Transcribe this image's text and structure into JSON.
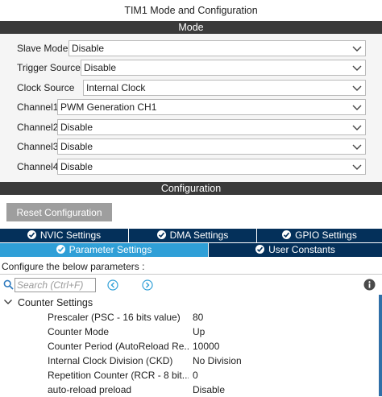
{
  "window": {
    "title": "TIM1 Mode and Configuration"
  },
  "mode": {
    "header": "Mode",
    "rows": [
      {
        "label": "Slave Mode",
        "value": "Disable"
      },
      {
        "label": "Trigger Source",
        "value": "Disable"
      },
      {
        "label": "Clock Source",
        "value": "Internal Clock"
      },
      {
        "label": "Channel1",
        "value": "PWM Generation CH1"
      },
      {
        "label": "Channel2",
        "value": "Disable"
      },
      {
        "label": "Channel3",
        "value": "Disable"
      },
      {
        "label": "Channel4",
        "value": "Disable"
      }
    ]
  },
  "configuration": {
    "header": "Configuration",
    "reset_label": "Reset Configuration",
    "tabs_row1": [
      {
        "label": "NVIC Settings"
      },
      {
        "label": "DMA Settings"
      },
      {
        "label": "GPIO Settings"
      }
    ],
    "tabs_row2": [
      {
        "label": "Parameter Settings",
        "active": true
      },
      {
        "label": "User Constants",
        "active": false
      }
    ],
    "hint": "Configure the below parameters :",
    "search": {
      "placeholder": "Search (Ctrl+F)"
    },
    "group": {
      "title": "Counter Settings",
      "params": [
        {
          "name": "Prescaler (PSC - 16 bits value)",
          "value": "80"
        },
        {
          "name": "Counter Mode",
          "value": "Up"
        },
        {
          "name": "Counter Period (AutoReload Re...",
          "value": "10000"
        },
        {
          "name": "Internal Clock Division (CKD)",
          "value": "No Division"
        },
        {
          "name": "Repetition Counter (RCR - 8 bit...",
          "value": "0"
        },
        {
          "name": "auto-reload preload",
          "value": "Disable"
        }
      ]
    }
  },
  "colors": {
    "section_bar": "#3a3a3a",
    "tab_dark": "#04305a",
    "tab_active": "#2f9fd7",
    "reset_button": "#9e9e9e"
  }
}
